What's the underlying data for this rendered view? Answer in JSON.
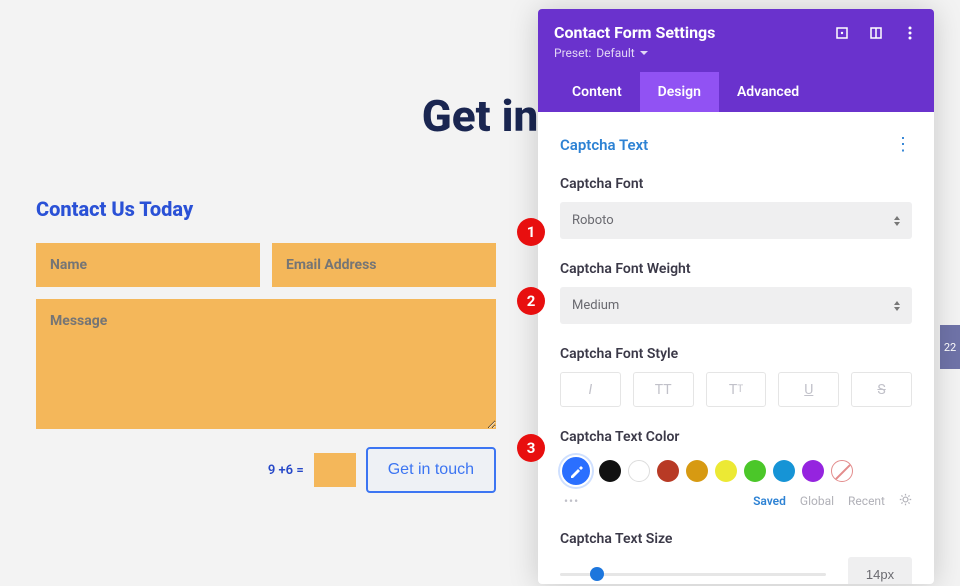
{
  "page": {
    "hero": "Get in",
    "contact_title": "Contact Us Today",
    "name_ph": "Name",
    "email_ph": "Email Address",
    "message_ph": "Message",
    "captcha_q": "9 +6 =",
    "submit": "Get in touch"
  },
  "panel": {
    "title": "Contact Form Settings",
    "preset_prefix": "Preset:",
    "preset_value": "Default",
    "tabs": [
      "Content",
      "Design",
      "Advanced"
    ],
    "active_tab": 1,
    "section_title": "Captcha Text",
    "font": {
      "label": "Captcha Font",
      "value": "Roboto"
    },
    "weight": {
      "label": "Captcha Font Weight",
      "value": "Medium"
    },
    "style": {
      "label": "Captcha Font Style",
      "buttons": [
        "italic",
        "fontcase",
        "fontcase2",
        "underline",
        "strike"
      ]
    },
    "color": {
      "label": "Captcha Text Color",
      "swatches": [
        "#2a6fff",
        "#111111",
        "#ffffff",
        "#b83a25",
        "#d79a12",
        "#ece934",
        "#4bc729",
        "#1694d6",
        "#9524df"
      ],
      "meta": {
        "saved": "Saved",
        "global": "Global",
        "recent": "Recent"
      }
    },
    "size": {
      "label": "Captcha Text Size",
      "value": "14px"
    }
  },
  "callouts": [
    "1",
    "2",
    "3"
  ],
  "scroll_hint": "22"
}
